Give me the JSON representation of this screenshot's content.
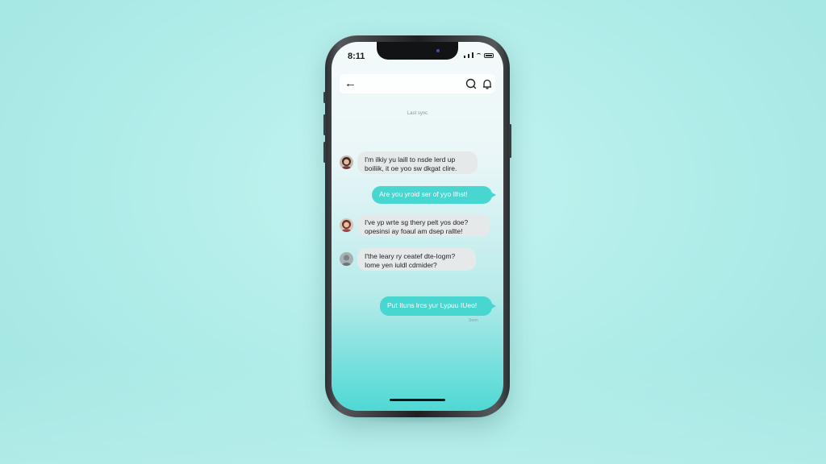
{
  "status_bar": {
    "time": "8:11"
  },
  "header": {
    "back_icon": "back-arrow-icon",
    "icons": [
      "chat-bubble-icon",
      "bell-icon"
    ]
  },
  "date_label": "Last sync",
  "messages": [
    {
      "direction": "incoming",
      "lines": [
        "I'm ilkiy yu laill to nsde lerd up",
        "boiliik, it oe yoo sw dkgat clire."
      ]
    },
    {
      "direction": "outgoing",
      "lines": [
        "Are you yroid ser of yyo Ilhst!"
      ]
    },
    {
      "direction": "incoming",
      "lines": [
        "I've yp wrte sg thery pelt yos doe?",
        "opesinsi ay foaul am dsep rallte!"
      ]
    },
    {
      "direction": "incoming",
      "lines": [
        "I'the leary ry ceatef dte-Iogm?",
        "Iome yen iuldl cdmider?"
      ]
    },
    {
      "direction": "outgoing",
      "lines": [
        "Put Ituns lrcs yur Lypuu IUeo!"
      ]
    }
  ],
  "last_message_time": "Seen",
  "colors": {
    "background": "#aeece8",
    "outgoing_bubble": "#48d6d0",
    "incoming_bubble": "#e6e9ea",
    "phone_frame": "#1d1f21"
  }
}
